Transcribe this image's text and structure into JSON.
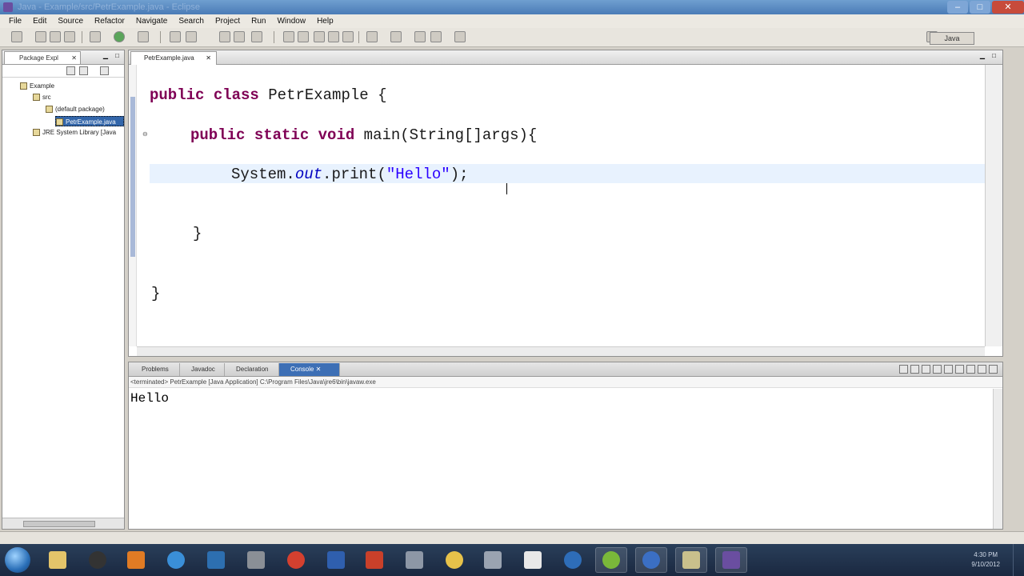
{
  "window": {
    "title": "Java - Example/src/PetrExample.java - Eclipse"
  },
  "menu": [
    "File",
    "Edit",
    "Source",
    "Refactor",
    "Navigate",
    "Search",
    "Project",
    "Run",
    "Window",
    "Help"
  ],
  "toolbar": {
    "perspective_label": "Java"
  },
  "package_explorer": {
    "tab_label": "Package Expl",
    "items": [
      {
        "label": "Example",
        "icon": "project-icon"
      },
      {
        "label": "src",
        "icon": "source-folder-icon"
      },
      {
        "label": "(default package)",
        "icon": "package-icon"
      },
      {
        "label": "PetrExample.java",
        "icon": "java-file-icon",
        "selected": true
      },
      {
        "label": "JRE System Library [Java",
        "icon": "library-icon"
      }
    ]
  },
  "editor": {
    "tab_label": "PetrExample.java",
    "code": {
      "l1": {
        "kw1": "public",
        "kw2": "class",
        "rest": " PetrExample {"
      },
      "l2": {
        "kw1": "public",
        "kw2": "static",
        "kw3": "void",
        "rest": " main(String[]args){"
      },
      "l3": {
        "a": "System.",
        "field": "out",
        "b": ".print(",
        "str": "\"Hello\"",
        "c": ");"
      },
      "l4": "}",
      "l5": "}"
    }
  },
  "console": {
    "tabs": [
      "Problems",
      "Javadoc",
      "Declaration",
      "Console"
    ],
    "status": "<terminated> PetrExample [Java Application] C:\\Program Files\\Java\\jre6\\bin\\javaw.exe",
    "output": "Hello"
  },
  "taskbar": {
    "clock_time": "4:30 PM",
    "clock_date": "9/10/2012"
  }
}
